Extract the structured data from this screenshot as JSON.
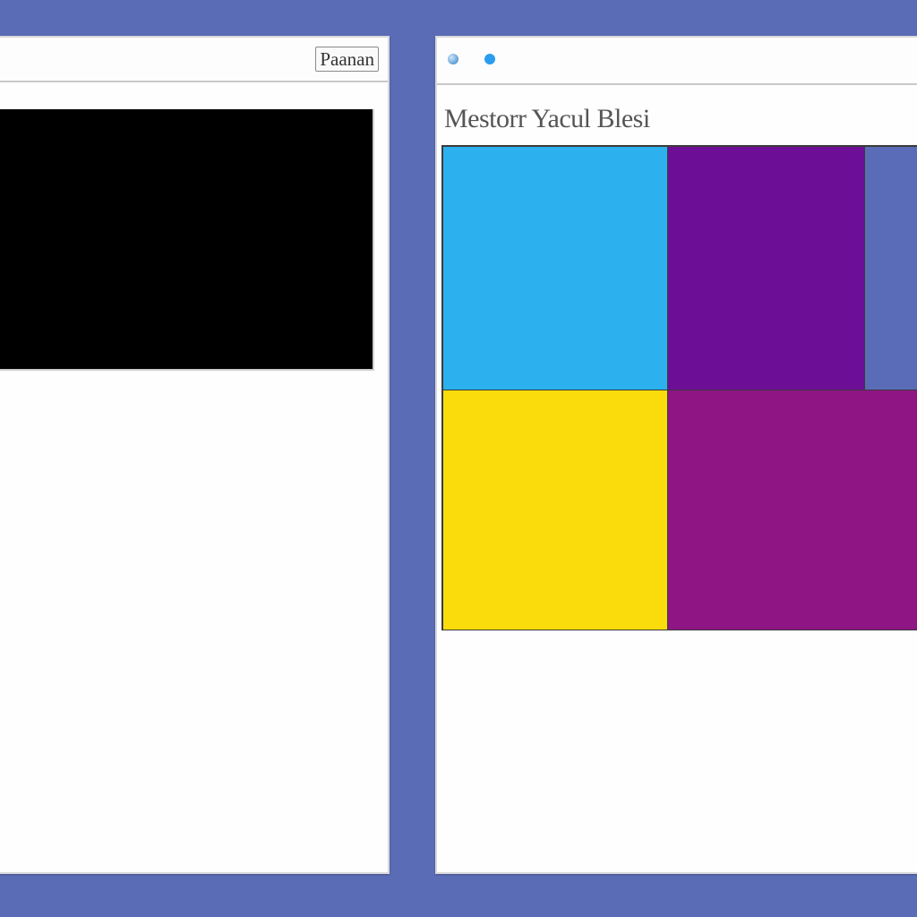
{
  "windows": {
    "left": {
      "titlebar_button_label": "Paanan"
    },
    "right": {
      "heading": "Mestorr Yacul Blesi"
    }
  },
  "colors": {
    "desktop": "#5b6cb7",
    "black_panel": "#000000",
    "tile_blue": "#2cb1ee",
    "tile_purple": "#6d0e96",
    "tile_slate": "#5a6cb8",
    "tile_yellow": "#fadb0c",
    "tile_magenta": "#8f1585"
  }
}
